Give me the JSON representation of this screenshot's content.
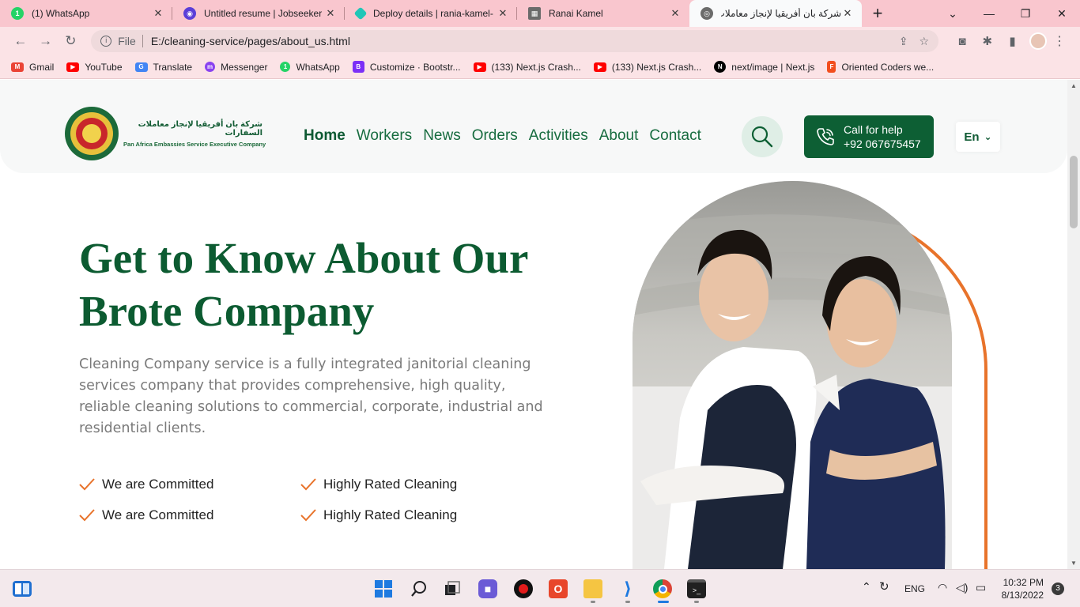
{
  "browser": {
    "tabs": [
      {
        "title": "(1) WhatsApp",
        "icon": "whatsapp-icon",
        "color": "#25d366",
        "badge": "1"
      },
      {
        "title": "Untitled resume | Jobseeker",
        "icon": "jobseeker-icon",
        "color": "#5a3ed8",
        "badge": ""
      },
      {
        "title": "Deploy details | rania-kamel-",
        "icon": "netlify-icon",
        "color": "#20c6b7",
        "badge": ""
      },
      {
        "title": "Ranai Kamel",
        "icon": "page-icon",
        "color": "#6b6b6b",
        "badge": ""
      },
      {
        "title": "شركة بان أفريقيا لإنجاز معاملات",
        "icon": "globe-icon",
        "color": "#6b6b6b",
        "badge": ""
      }
    ],
    "address": {
      "scheme": "File",
      "url": "E:/cleaning-service/pages/about_us.html"
    },
    "bookmarks": [
      {
        "label": "Gmail",
        "color": "#ea4335",
        "glyph": "M"
      },
      {
        "label": "YouTube",
        "color": "#ff0000",
        "glyph": "▶"
      },
      {
        "label": "Translate",
        "color": "#4285f4",
        "glyph": "G"
      },
      {
        "label": "Messenger",
        "color": "#8a43f0",
        "glyph": "m"
      },
      {
        "label": "WhatsApp",
        "color": "#25d366",
        "glyph": "1"
      },
      {
        "label": "Customize · Bootstr...",
        "color": "#7b2ff7",
        "glyph": "B"
      },
      {
        "label": "(133) Next.js Crash...",
        "color": "#ff0000",
        "glyph": "▶"
      },
      {
        "label": "(133) Next.js Crash...",
        "color": "#ff0000",
        "glyph": "▶"
      },
      {
        "label": "next/image | Next.js",
        "color": "#000000",
        "glyph": "N"
      },
      {
        "label": "Oriented Coders we...",
        "color": "#f24e1e",
        "glyph": "F"
      }
    ]
  },
  "site": {
    "logo": {
      "arabic": "شركة بان أفريقيا لإنجاز معاملات السفارات",
      "english": "Pan Africa Embassies Service Executive Company"
    },
    "nav": [
      "Home",
      "Workers",
      "News",
      "Orders",
      "Activities",
      "About",
      "Contact"
    ],
    "call": {
      "label": "Call for help",
      "number": "+92 067675457"
    },
    "language": "En",
    "hero": {
      "title_line1": "Get to Know About Our",
      "title_line2": "Brote Company",
      "description": "Cleaning Company service is a fully integrated janitorial cleaning services company that provides comprehensive, high quality, reliable cleaning solutions to commercial, corporate, industrial and residential clients.",
      "features": [
        [
          "We are Committed",
          "Highly Rated Cleaning"
        ],
        [
          "We are Committed",
          "Highly Rated Cleaning"
        ]
      ]
    },
    "colors": {
      "primary": "#0c5b31",
      "accent": "#e8732b"
    }
  },
  "taskbar": {
    "language": "ENG",
    "time": "10:32 PM",
    "date": "8/13/2022",
    "notifications": "3"
  }
}
